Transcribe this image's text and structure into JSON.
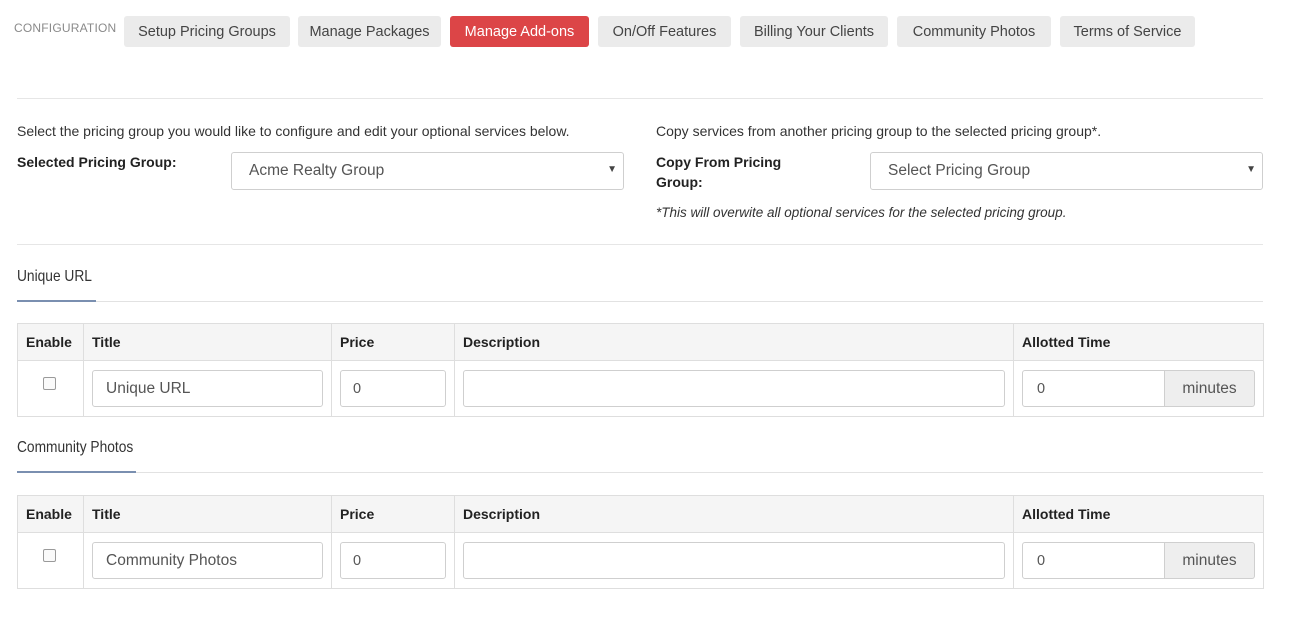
{
  "nav": {
    "label": "CONFIGURATION",
    "items": [
      {
        "label": "Setup Pricing Groups",
        "active": false
      },
      {
        "label": "Manage Packages",
        "active": false
      },
      {
        "label": "Manage Add-ons",
        "active": true
      },
      {
        "label": "On/Off Features",
        "active": false
      },
      {
        "label": "Billing Your Clients",
        "active": false
      },
      {
        "label": "Community Photos",
        "active": false
      },
      {
        "label": "Terms of Service",
        "active": false
      }
    ]
  },
  "pricing": {
    "hint": "Select the pricing group you would like to configure and edit your optional services below.",
    "label": "Selected Pricing Group:",
    "selected": "Acme Realty Group"
  },
  "copy": {
    "hint": "Copy services from another pricing group to the selected pricing group*.",
    "label_line1": "Copy From Pricing",
    "label_line2": "Group:",
    "placeholder": "Select Pricing Group",
    "note": "*This will overwite all optional services for the selected pricing group."
  },
  "columns": {
    "enable": "Enable",
    "title": "Title",
    "price": "Price",
    "description": "Description",
    "allotted_time": "Allotted Time"
  },
  "sections": [
    {
      "heading": "Unique URL",
      "enabled": false,
      "title": "Unique URL",
      "price": "0",
      "description": "",
      "time": "0",
      "unit": "minutes"
    },
    {
      "heading": "Community Photos",
      "enabled": false,
      "title": "Community Photos",
      "price": "0",
      "description": "",
      "time": "0",
      "unit": "minutes"
    }
  ],
  "colors": {
    "accent": "#dc4547",
    "section_underline": "#7a8fb0"
  }
}
